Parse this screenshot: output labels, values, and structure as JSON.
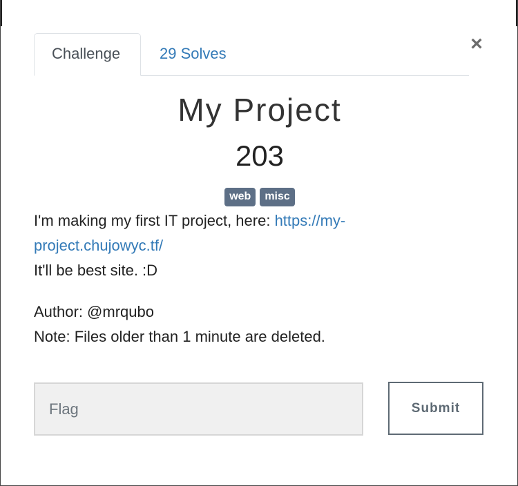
{
  "tabs": [
    {
      "label": "Challenge",
      "active": true
    },
    {
      "label": "29 Solves",
      "active": false
    }
  ],
  "close_label": "×",
  "challenge": {
    "name": "My Project",
    "points": "203",
    "tags": [
      "web",
      "misc"
    ],
    "description": {
      "line1_text": "I'm making my first IT project, here: ",
      "line1_link": "https://my-project.chujowyc.tf/",
      "line2": "It'll be best site. :D",
      "author": "Author: @mrqubo",
      "note": "Note: Files older than 1 minute are deleted."
    }
  },
  "flag_form": {
    "placeholder": "Flag",
    "value": "",
    "submit_label": "Submit"
  },
  "colors": {
    "link": "#337ab7",
    "tag_bg": "#5d6f86",
    "submit_border": "#5e6a74"
  }
}
